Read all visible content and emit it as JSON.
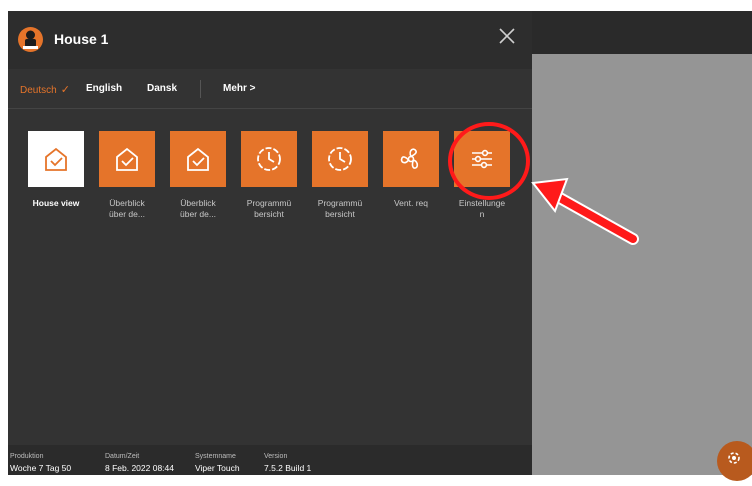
{
  "header": {
    "title": "House 1"
  },
  "languages": {
    "items": [
      "Deutsch",
      "English",
      "Dansk"
    ],
    "more": "Mehr >"
  },
  "tiles": [
    {
      "line1": "House view",
      "line2": ""
    },
    {
      "line1": "Überblick",
      "line2": "über de..."
    },
    {
      "line1": "Überblick",
      "line2": "über de..."
    },
    {
      "line1": "Programmü",
      "line2": "bersicht"
    },
    {
      "line1": "Programmü",
      "line2": "bersicht"
    },
    {
      "line1": "Vent. req",
      "line2": ""
    },
    {
      "line1": "Einstellunge",
      "line2": "n"
    }
  ],
  "footer": {
    "produktion_label": "Produktion",
    "produktion_value": "Woche 7 Tag 50",
    "datum_label": "Datum/Zeit",
    "datum_value": "8 Feb. 2022 08:44",
    "system_label": "Systemname",
    "system_value": "Viper Touch",
    "version_label": "Version",
    "version_value": "7.5.2 Build 1"
  },
  "colors": {
    "accent": "#e5742a",
    "annotation": "#ff1a1a",
    "panel": "#333333"
  },
  "icons": [
    "close-icon",
    "checkmark-icon",
    "house-check-icon",
    "clock-icon",
    "fan-icon",
    "sliders-icon",
    "gear-icon"
  ]
}
